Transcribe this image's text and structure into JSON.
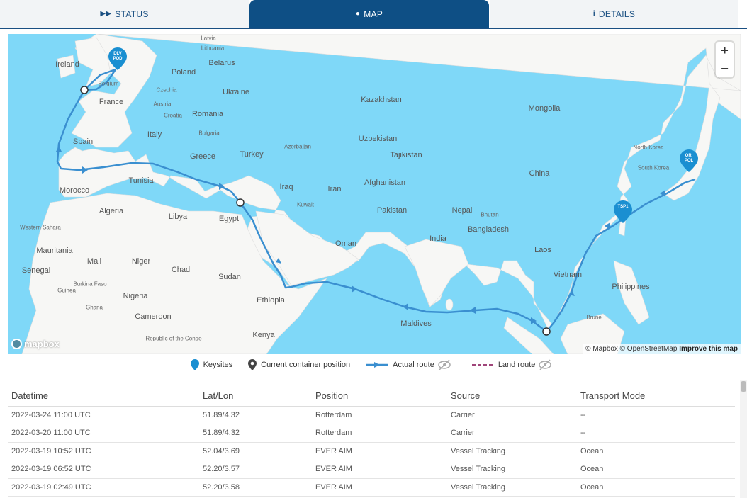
{
  "tabs": [
    {
      "label": "STATUS",
      "icon": "fast-forward-icon"
    },
    {
      "label": "MAP",
      "icon": "globe-icon"
    },
    {
      "label": "DETAILS",
      "icon": "info-icon"
    }
  ],
  "map": {
    "labels": [
      {
        "t": "Latvia",
        "s": "sm"
      },
      {
        "t": "Lithuania",
        "s": "sm"
      },
      {
        "t": "Ireland",
        "s": ""
      },
      {
        "t": "Belarus",
        "s": ""
      },
      {
        "t": "Poland",
        "s": ""
      },
      {
        "t": "Belgium",
        "s": "sm"
      },
      {
        "t": "Czechia",
        "s": "sm"
      },
      {
        "t": "Ukraine",
        "s": ""
      },
      {
        "t": "France",
        "s": ""
      },
      {
        "t": "Austria",
        "s": "sm"
      },
      {
        "t": "Croatia",
        "s": "sm"
      },
      {
        "t": "Romania",
        "s": ""
      },
      {
        "t": "Kazakhstan",
        "s": ""
      },
      {
        "t": "Mongolia",
        "s": ""
      },
      {
        "t": "Italy",
        "s": ""
      },
      {
        "t": "Bulgaria",
        "s": "sm"
      },
      {
        "t": "Spain",
        "s": ""
      },
      {
        "t": "Uzbekistan",
        "s": ""
      },
      {
        "t": "Greece",
        "s": ""
      },
      {
        "t": "Azerbaijan",
        "s": "sm"
      },
      {
        "t": "Turkey",
        "s": ""
      },
      {
        "t": "Tajikistan",
        "s": ""
      },
      {
        "t": "North Korea",
        "s": "sm"
      },
      {
        "t": "China",
        "s": ""
      },
      {
        "t": "South Korea",
        "s": "sm"
      },
      {
        "t": "Tunisia",
        "s": ""
      },
      {
        "t": "Iraq",
        "s": ""
      },
      {
        "t": "Iran",
        "s": ""
      },
      {
        "t": "Afghanistan",
        "s": ""
      },
      {
        "t": "Morocco",
        "s": ""
      },
      {
        "t": "Kuwait",
        "s": "sm"
      },
      {
        "t": "Algeria",
        "s": ""
      },
      {
        "t": "Libya",
        "s": ""
      },
      {
        "t": "Egypt",
        "s": ""
      },
      {
        "t": "Pakistan",
        "s": ""
      },
      {
        "t": "Nepal",
        "s": ""
      },
      {
        "t": "Bhutan",
        "s": "sm"
      },
      {
        "t": "Western Sahara",
        "s": "sm"
      },
      {
        "t": "Bangladesh",
        "s": ""
      },
      {
        "t": "India",
        "s": ""
      },
      {
        "t": "Oman",
        "s": ""
      },
      {
        "t": "Mauritania",
        "s": ""
      },
      {
        "t": "Laos",
        "s": ""
      },
      {
        "t": "Mali",
        "s": ""
      },
      {
        "t": "Niger",
        "s": ""
      },
      {
        "t": "Chad",
        "s": ""
      },
      {
        "t": "Senegal",
        "s": ""
      },
      {
        "t": "Sudan",
        "s": ""
      },
      {
        "t": "Vietnam",
        "s": ""
      },
      {
        "t": "Burkina Faso",
        "s": "sm"
      },
      {
        "t": "Guinea",
        "s": "sm"
      },
      {
        "t": "Philippines",
        "s": ""
      },
      {
        "t": "Nigeria",
        "s": ""
      },
      {
        "t": "Ethiopia",
        "s": ""
      },
      {
        "t": "Ghana",
        "s": "sm"
      },
      {
        "t": "Maldives",
        "s": ""
      },
      {
        "t": "Cameroon",
        "s": ""
      },
      {
        "t": "Brunei",
        "s": "sm"
      },
      {
        "t": "Republic of the Congo",
        "s": "sm"
      },
      {
        "t": "Kenya",
        "s": ""
      }
    ],
    "pins": [
      {
        "line1": "DLV",
        "line2": "POD"
      },
      {
        "line1": "TSP1",
        "line2": ""
      },
      {
        "line1": "ORI",
        "line2": "POL"
      }
    ],
    "zoom_in": "+",
    "zoom_out": "−",
    "logo": "mapbox",
    "attribution": "© Mapbox © OpenStreetMap",
    "improve": "Improve this map",
    "route_color": "#3a8fd0",
    "pin_color": "#1a8fd1"
  },
  "legend": {
    "keysites": "Keysites",
    "current": "Current container position",
    "actual": "Actual route",
    "land": "Land route"
  },
  "table": {
    "headers": [
      "Datetime",
      "Lat/Lon",
      "Position",
      "Source",
      "Transport Mode"
    ],
    "rows": [
      [
        "2022-03-24 11:00 UTC",
        "51.89/4.32",
        "Rotterdam",
        "Carrier",
        "--"
      ],
      [
        "2022-03-20 11:00 UTC",
        "51.89/4.32",
        "Rotterdam",
        "Carrier",
        "--"
      ],
      [
        "2022-03-19 10:52 UTC",
        "52.04/3.69",
        "EVER AIM",
        "Vessel Tracking",
        "Ocean"
      ],
      [
        "2022-03-19 06:52 UTC",
        "52.20/3.57",
        "EVER AIM",
        "Vessel Tracking",
        "Ocean"
      ],
      [
        "2022-03-19 02:49 UTC",
        "52.20/3.58",
        "EVER AIM",
        "Vessel Tracking",
        "Ocean"
      ]
    ]
  }
}
